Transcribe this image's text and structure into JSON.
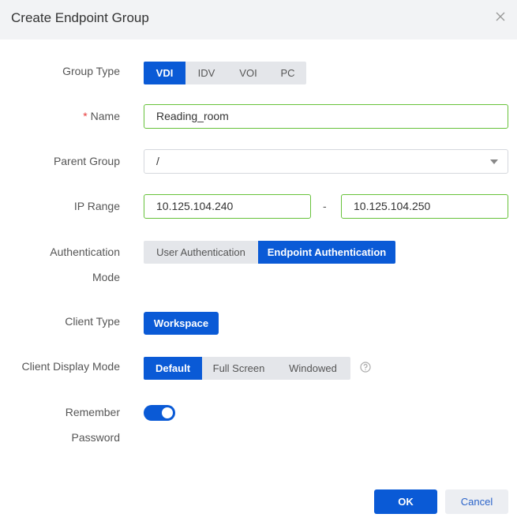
{
  "dialog": {
    "title": "Create Endpoint Group"
  },
  "form": {
    "group_type": {
      "label": "Group Type",
      "options": [
        "VDI",
        "IDV",
        "VOI",
        "PC"
      ],
      "selected": "VDI"
    },
    "name": {
      "label": "Name",
      "required_mark": "*",
      "value": "Reading_room"
    },
    "parent_group": {
      "label": "Parent Group",
      "value": "/"
    },
    "ip_range": {
      "label": "IP Range",
      "start": "10.125.104.240",
      "separator": "-",
      "end": "10.125.104.250"
    },
    "auth_mode": {
      "label_line1": "Authentication",
      "label_line2": "Mode",
      "options": [
        "User Authentication",
        "Endpoint Authentication"
      ],
      "selected": "Endpoint Authentication"
    },
    "client_type": {
      "label": "Client Type",
      "value": "Workspace"
    },
    "display_mode": {
      "label": "Client Display Mode",
      "options": [
        "Default",
        "Full Screen",
        "Windowed"
      ],
      "selected": "Default"
    },
    "remember_password": {
      "label_line1": "Remember",
      "label_line2": "Password",
      "enabled": true
    }
  },
  "footer": {
    "ok_label": "OK",
    "cancel_label": "Cancel"
  },
  "colors": {
    "primary": "#0a5ad6",
    "valid_border": "#67c23a",
    "required": "#e83b3b"
  }
}
